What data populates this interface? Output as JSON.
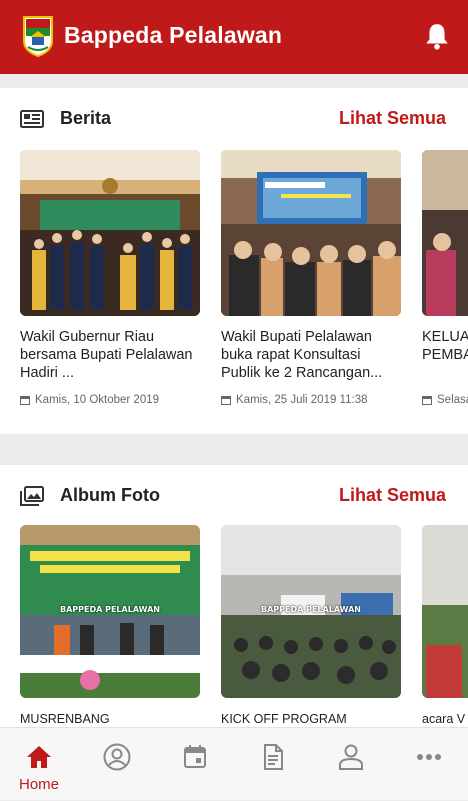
{
  "app": {
    "title": "Bappeda Pelalawan"
  },
  "colors": {
    "primary": "#c0191a"
  },
  "news": {
    "title": "Berita",
    "see_all": "Lihat Semua",
    "items": [
      {
        "title": "Wakil Gubernur Riau bersama Bupati Pelalawan Hadiri ...",
        "date": "Kamis, 10 Oktober 2019"
      },
      {
        "title": "Wakil Bupati Pelalawan buka rapat  Konsultasi Publik ke 2 Rancangan...",
        "date": "Kamis, 25 Juli 2019 11:38"
      },
      {
        "title": "KELUARAN BADAN PEMBANGUNAN",
        "date": "Selasa"
      }
    ]
  },
  "album": {
    "title": "Album Foto",
    "see_all": "Lihat Semua",
    "watermark": "BAPPEDA PELALAWAN",
    "items": [
      {
        "label": "MUSRENBANG"
      },
      {
        "label": "KICK OFF PROGRAM"
      },
      {
        "label": "acara V"
      }
    ]
  },
  "nav": {
    "items": [
      {
        "icon": "home-icon",
        "label": "Home",
        "active": true
      },
      {
        "icon": "profile-icon"
      },
      {
        "icon": "calendar-icon"
      },
      {
        "icon": "document-icon"
      },
      {
        "icon": "person-icon"
      },
      {
        "icon": "more-icon"
      }
    ]
  }
}
